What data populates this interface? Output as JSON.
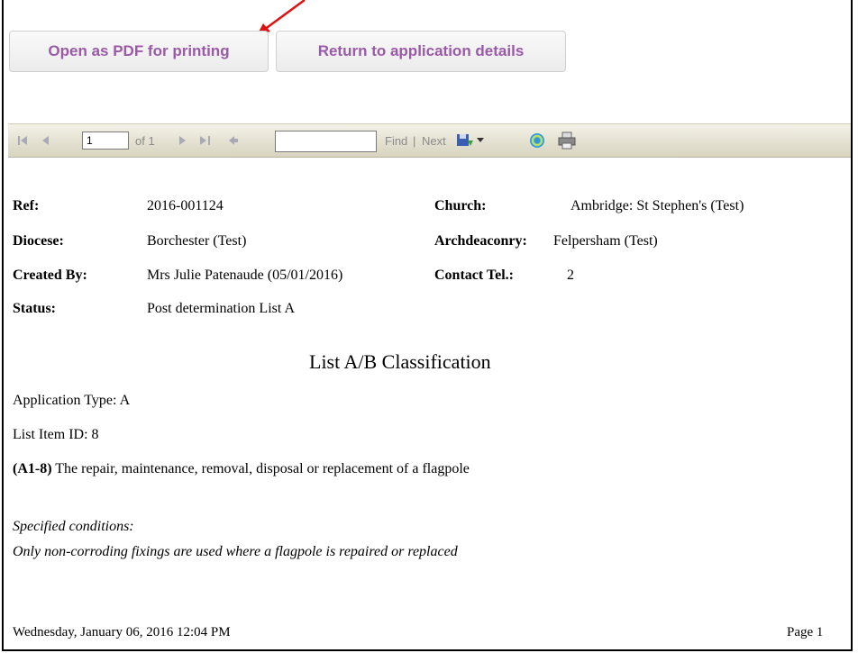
{
  "buttons": {
    "pdf_label": "Open as PDF for printing",
    "return_label": "Return to application details"
  },
  "toolbar": {
    "page_value": "1",
    "of_label": "of 1",
    "find_label": "Find",
    "separator": "|",
    "next_label": "Next",
    "icons": [
      "first-page-icon",
      "previous-page-icon",
      "next-page-icon",
      "last-page-icon",
      "back-icon",
      "export-icon",
      "dropdown-icon",
      "refresh-icon",
      "print-icon"
    ]
  },
  "fields": {
    "ref_label": "Ref:",
    "ref_value": "2016-001124",
    "diocese_label": "Diocese:",
    "diocese_value": "Borchester (Test)",
    "created_label": "Created By:",
    "created_value": "Mrs Julie Patenaude (05/01/2016)",
    "status_label": "Status:",
    "status_value": "Post determination List A",
    "church_label": "Church:",
    "church_value": "Ambridge: St Stephen's (Test)",
    "archdeaconry_label": "Archdeaconry:",
    "archdeaconry_value": "Felpersham (Test)",
    "contact_label": "Contact Tel.:",
    "contact_value": "2"
  },
  "classification": {
    "title": "List A/B Classification",
    "application_type": "Application Type: A",
    "list_item_id": "List Item ID: 8",
    "item_code": "(A1-8)",
    "item_text": " The repair, maintenance, removal, disposal or replacement of a flagpole",
    "conditions_heading": "Specified conditions:",
    "conditions_text": "Only non-corroding fixings are used where a flagpole is repaired or replaced"
  },
  "footer": {
    "timestamp": "Wednesday, January 06, 2016 12:04 PM",
    "page_label": "Page 1"
  },
  "colors": {
    "button_text": "#9a5aa8",
    "arrow": "#e01010",
    "toolbar_bg": "#e2dfcf"
  }
}
